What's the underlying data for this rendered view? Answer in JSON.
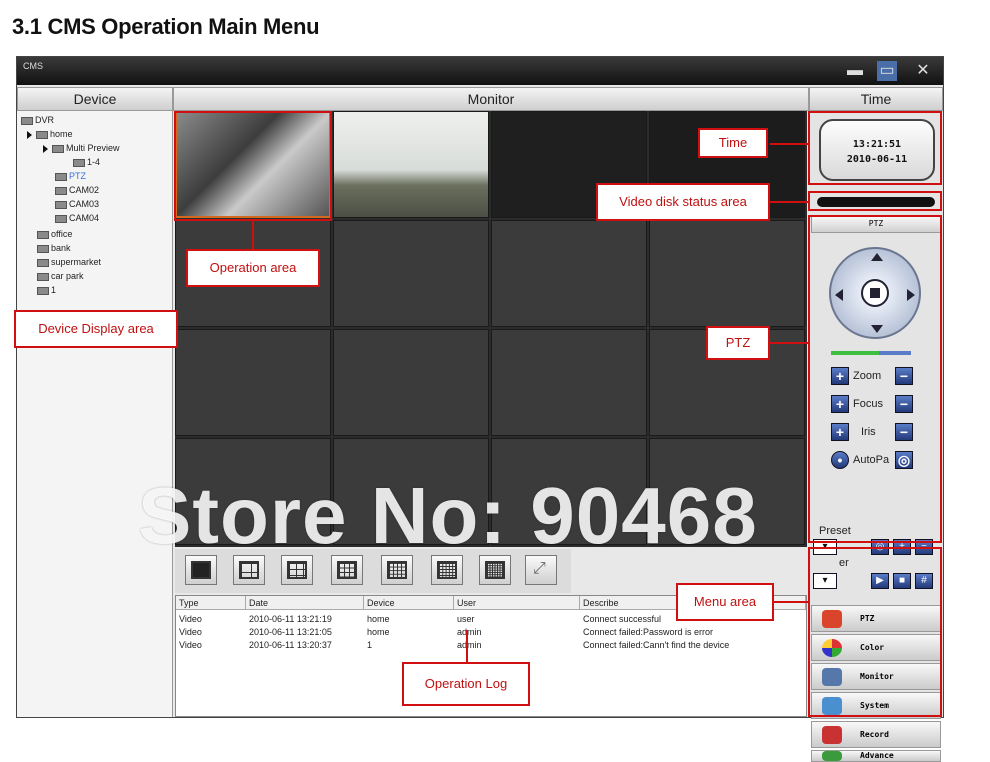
{
  "page": {
    "heading": "3.1 CMS Operation Main Menu"
  },
  "window": {
    "title": "CMS",
    "minimize_icon": "minimize-icon",
    "restore_icon": "restore-icon",
    "close_icon": "close-icon"
  },
  "columns": {
    "device": "Device",
    "monitor": "Monitor",
    "time": "Time"
  },
  "tree": [
    {
      "label": "DVR",
      "icon": "computer-icon"
    },
    {
      "label": "home",
      "icon": "dvr-icon"
    },
    {
      "label": "Multi Preview",
      "icon": "camera-icon"
    },
    {
      "label": "1-4",
      "icon": "camera-icon"
    },
    {
      "label": "PTZ",
      "icon": "camera-icon"
    },
    {
      "label": "CAM02",
      "icon": "camera-icon"
    },
    {
      "label": "CAM03",
      "icon": "camera-icon"
    },
    {
      "label": "CAM04",
      "icon": "camera-icon"
    },
    {
      "label": "office",
      "icon": "dvr-icon"
    },
    {
      "label": "bank",
      "icon": "dvr-icon"
    },
    {
      "label": "supermarket",
      "icon": "dvr-icon"
    },
    {
      "label": "car park",
      "icon": "dvr-icon"
    },
    {
      "label": "1",
      "icon": "dvr-icon"
    }
  ],
  "clock": {
    "time": "13:21:51",
    "date": "2010-06-11"
  },
  "ptz": {
    "header": "PTZ",
    "zoom": "Zoom",
    "focus": "Focus",
    "iris": "Iris",
    "autopan": "AutoPa",
    "preset": "Preset",
    "cruise": "er"
  },
  "menu": [
    {
      "label": "PTZ",
      "icon": "ptz-icon",
      "color": "#d9442b"
    },
    {
      "label": "Color",
      "icon": "color-icon",
      "color": "#e0a020"
    },
    {
      "label": "Monitor",
      "icon": "monitor-icon",
      "color": "#5577aa"
    },
    {
      "label": "System",
      "icon": "system-icon",
      "color": "#4a8fd0"
    },
    {
      "label": "Record",
      "icon": "record-icon",
      "color": "#c83232"
    },
    {
      "label": "Advance",
      "icon": "advance-icon",
      "color": "#3b9a3b"
    }
  ],
  "log": {
    "headers": [
      "Type",
      "Date",
      "Device",
      "User",
      "Describe"
    ],
    "rows": [
      [
        "Video",
        "2010-06-11 13:21:19",
        "home",
        "user",
        "Connect successful"
      ],
      [
        "Video",
        "2010-06-11 13:21:05",
        "home",
        "admin",
        "Connect failed:Password is error"
      ],
      [
        "Video",
        "2010-06-11 13:20:37",
        "1",
        "admin",
        "Connect failed:Cann't find the device"
      ]
    ]
  },
  "annotations": {
    "time": "Time",
    "video_disk": "Video disk status area",
    "operation": "Operation area",
    "device_display": "Device Display area",
    "ptz": "PTZ",
    "menu": "Menu area",
    "operation_log": "Operation Log"
  },
  "watermark": "Store No: 90468"
}
